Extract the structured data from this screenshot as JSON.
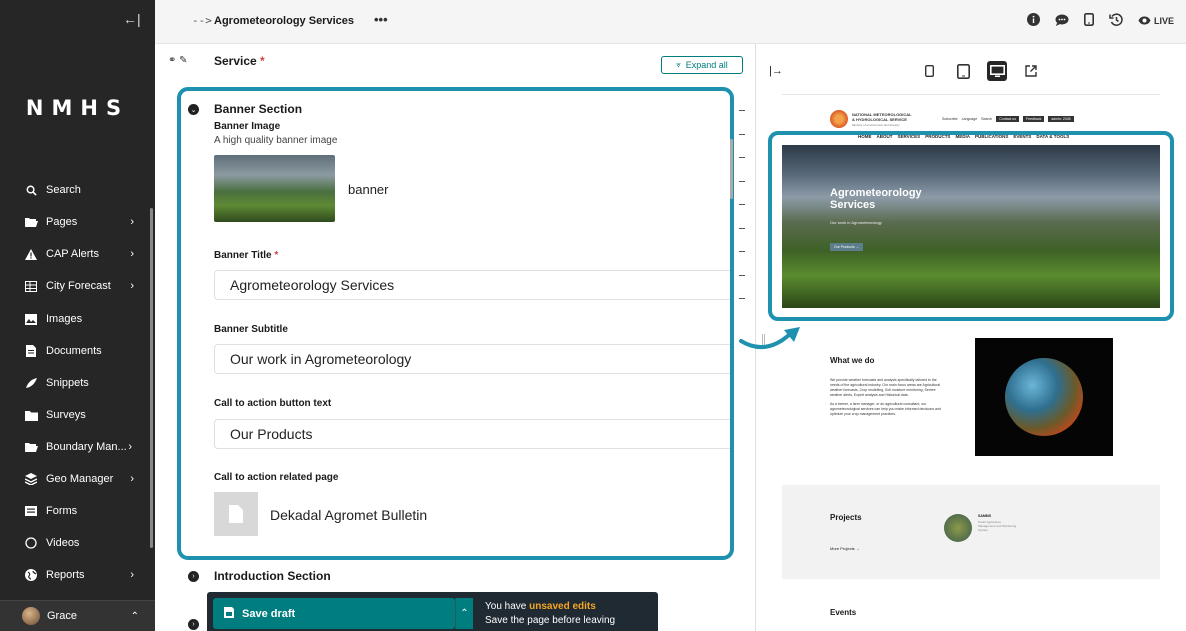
{
  "sidebar": {
    "collapse_icon": "arrow-left-bar-icon",
    "logo": "NMHS",
    "items": [
      {
        "label": "Search",
        "icon": "search-icon",
        "chevron": ""
      },
      {
        "label": "Pages",
        "icon": "folder-open-icon",
        "chevron": "›"
      },
      {
        "label": "CAP Alerts",
        "icon": "warning-icon",
        "chevron": "›"
      },
      {
        "label": "City Forecast",
        "icon": "table-icon",
        "chevron": "›"
      },
      {
        "label": "Images",
        "icon": "image-icon",
        "chevron": ""
      },
      {
        "label": "Documents",
        "icon": "document-icon",
        "chevron": ""
      },
      {
        "label": "Snippets",
        "icon": "snippet-icon",
        "chevron": ""
      },
      {
        "label": "Surveys",
        "icon": "folder-icon",
        "chevron": ""
      },
      {
        "label": "Boundary Man...",
        "icon": "folder-open-icon",
        "chevron": "›"
      },
      {
        "label": "Geo Manager",
        "icon": "layers-icon",
        "chevron": "›"
      },
      {
        "label": "Forms",
        "icon": "form-icon",
        "chevron": ""
      },
      {
        "label": "Videos",
        "icon": "circle-icon",
        "chevron": ""
      },
      {
        "label": "Reports",
        "icon": "globe-icon",
        "chevron": "›"
      }
    ],
    "user": {
      "name": "Grace",
      "chevron": "⌃"
    }
  },
  "topbar": {
    "arrow": "-->",
    "title": "Agrometeorology Services",
    "more": "•••",
    "live_label": "LIVE"
  },
  "editor": {
    "section_title": "Service",
    "required_mark": "*",
    "expand_all": "Expand all",
    "banner_section": {
      "title": "Banner Section",
      "image_label": "Banner Image",
      "image_help": "A high quality banner image",
      "image_name": "banner",
      "title_label": "Banner Title",
      "title_value": "Agrometeorology Services",
      "subtitle_label": "Banner Subtitle",
      "subtitle_value": "Our work in Agrometeorology",
      "cta_label": "Call to action button text",
      "cta_value": "Our Products",
      "related_label": "Call to action related page",
      "related_value": "Dekadal Agromet Bulletin"
    },
    "intro_section": "Introduction Section"
  },
  "savebar": {
    "save_label": "Save draft",
    "unsaved_prefix": "You have ",
    "unsaved_highlight": "unsaved edits",
    "unsaved_sub": "Save the page before leaving"
  },
  "preview": {
    "site": {
      "name_line1": "NATIONAL METEOROLOGICAL",
      "name_line2": "& HYDROLOGICAL SERVICE",
      "tagline": "Ministry of environment and forestry",
      "util": [
        "Subscribe",
        "Language",
        "Search"
      ],
      "util_buttons": [
        "Contact us",
        "Feedback",
        "admin: 2345"
      ],
      "nav": [
        "HOME",
        "ABOUT",
        "SERVICES",
        "PRODUCTS",
        "MEDIA",
        "PUBLICATIONS",
        "EVENTS",
        "DATA & TOOLS"
      ],
      "hero_title": "Agrometeorology Services",
      "hero_sub": "Our work in Agrometeorology",
      "hero_btn": "Our Products →",
      "wwd_title": "What we do",
      "wwd_p1": "We provide weather forecasts and analysis specifically tailored to the needs of the agricultural industry. Our main focus areas are Agricultural weather forecasts, Crop modelling, Soil moisture monitoring, Severe weather alerts, Expert analysis and Historical data.",
      "wwd_p2": "As a farmer, a farm manager, or an agricultural consultant, our agrometeorological services can help you make informed decisions and optimize your crop management practices.",
      "projects_title": "Projects",
      "projects_more": "More Projects →",
      "project_name": "SAMMS",
      "project_desc": "Smart Agriculture Management and Monitoring System",
      "events_title": "Events"
    }
  }
}
